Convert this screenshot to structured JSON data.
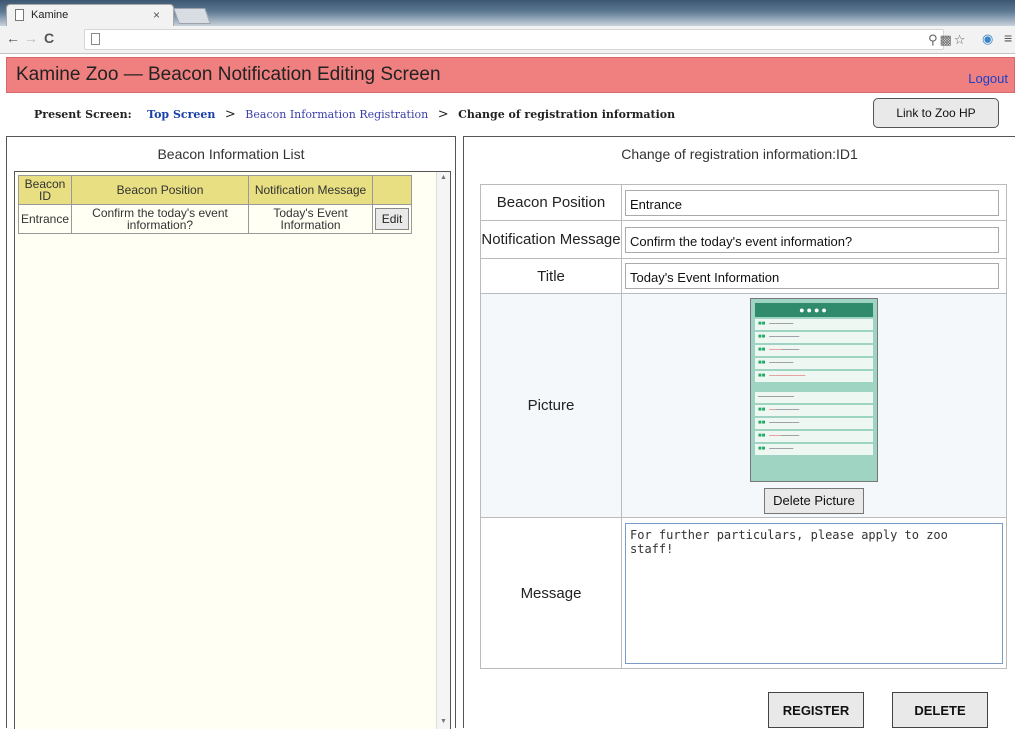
{
  "browser": {
    "tab_title": "Kamine",
    "tab_close": "×"
  },
  "header": {
    "title": "Kamine Zoo — Beacon Notification Editing Screen",
    "logout": "Logout",
    "bg_color": "#f08080"
  },
  "breadcrumb": {
    "label": "Present Screen:",
    "items": [
      "Top Screen",
      "Beacon Information Registration",
      "Change of registration information"
    ],
    "separator": ">",
    "zoo_hp_button": "Link to Zoo HP"
  },
  "list_panel": {
    "title": "Beacon Information List",
    "columns": [
      "Beacon ID",
      "Beacon Position",
      "Notification Message"
    ],
    "rows": [
      {
        "beacon_id": "Entrance",
        "position": "Confirm the today's event information?",
        "message": "Today's Event Information",
        "edit_label": "Edit"
      }
    ]
  },
  "edit_panel": {
    "title": "Change of registration information:ID1",
    "fields": {
      "beacon_position": {
        "label": "Beacon Position",
        "value": "Entrance"
      },
      "notification_message": {
        "label": "Notification Message",
        "value": "Confirm the today's event information?"
      },
      "title": {
        "label": "Title",
        "value": "Today's Event Information"
      },
      "picture": {
        "label": "Picture",
        "delete_label": "Delete Picture"
      },
      "message": {
        "label": "Message",
        "value": "For further particulars, please apply to zoo staff!"
      }
    },
    "register_label": "REGISTER",
    "delete_label": "DELETE"
  }
}
